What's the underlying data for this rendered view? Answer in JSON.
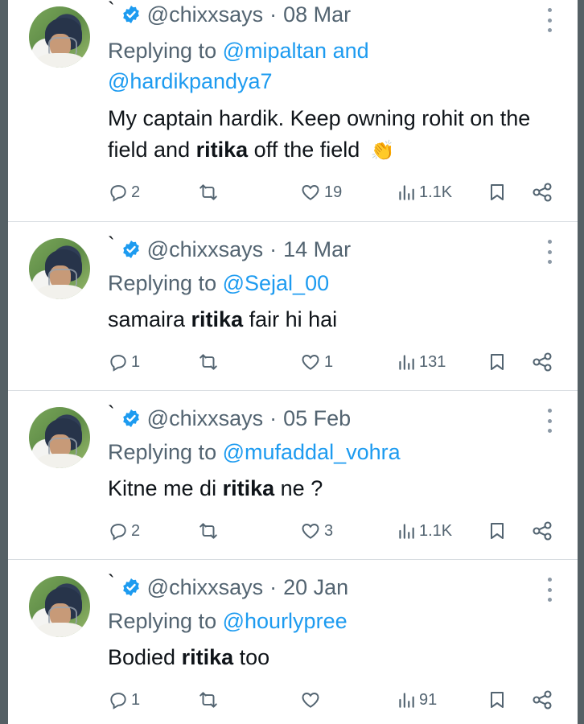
{
  "tweets": [
    {
      "prefix": "`",
      "handle": "@chixxsays",
      "separator": "·",
      "date": "08 Mar",
      "replying_prefix": "Replying to",
      "reply_targets_line1": "@mipaltan and",
      "reply_targets_line2": "@hardikpandya7",
      "text_part1": "My captain hardik. Keep owning rohit on the field and",
      "text_bold": "ritika",
      "text_part2": "off the field",
      "emoji": "👏",
      "replies": "2",
      "retweets": "",
      "likes": "19",
      "views": "1.1K"
    },
    {
      "prefix": "`",
      "handle": "@chixxsays",
      "separator": "·",
      "date": "14 Mar",
      "replying_prefix": "Replying to",
      "reply_targets_line1": "@Sejal_00",
      "text_part1": "samaira",
      "text_bold": "ritika",
      "text_part2": "fair hi hai",
      "replies": "1",
      "retweets": "",
      "likes": "1",
      "views": "131"
    },
    {
      "prefix": "`",
      "handle": "@chixxsays",
      "separator": "·",
      "date": "05 Feb",
      "replying_prefix": "Replying to",
      "reply_targets_line1": "@mufaddal_vohra",
      "text_part1": "Kitne me di",
      "text_bold": "ritika",
      "text_part2": "ne ?",
      "replies": "2",
      "retweets": "",
      "likes": "3",
      "views": "1.1K"
    },
    {
      "prefix": "`",
      "handle": "@chixxsays",
      "separator": "·",
      "date": "20 Jan",
      "replying_prefix": "Replying to",
      "reply_targets_line1": "@hourlypree",
      "text_part1": "Bodied",
      "text_bold": "ritika",
      "text_part2": "too",
      "replies": "1",
      "retweets": "",
      "likes": "",
      "views": "91"
    }
  ],
  "icons": {
    "verified": "verified-badge-icon",
    "reply": "reply-bubble-icon",
    "retweet": "retweet-icon",
    "like": "heart-icon",
    "views": "views-bars-icon",
    "bookmark": "bookmark-icon",
    "share": "share-icon",
    "more": "more-dots-icon"
  },
  "colors": {
    "link": "#1d9bf0",
    "verified": "#1d9bf0",
    "muted": "#536471",
    "text": "#0f1419",
    "divider": "#d8dde1",
    "frame_edge": "#556065"
  }
}
